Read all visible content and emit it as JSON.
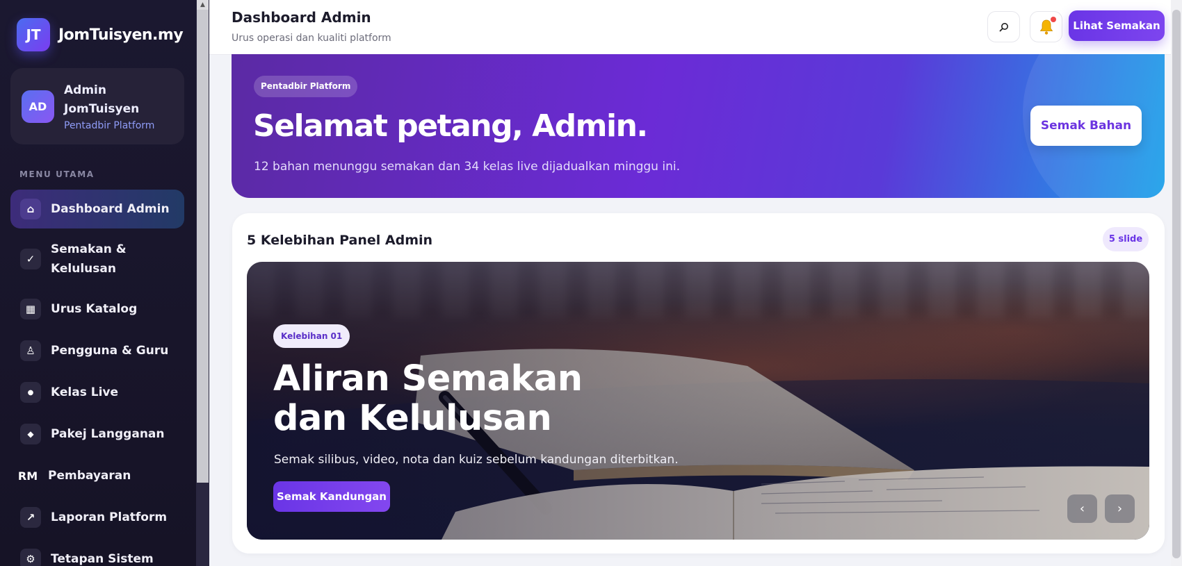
{
  "brand": {
    "logo": "JT",
    "name": "JomTuisyen.my"
  },
  "profile": {
    "initials": "AD",
    "name": "Admin JomTuisyen",
    "role": "Pentadbir Platform"
  },
  "menu": {
    "heading": "MENU UTAMA",
    "items": [
      {
        "label": "Dashboard Admin",
        "icon": "home-icon",
        "glyph": "⌂"
      },
      {
        "label": "Semakan & Kelulusan",
        "icon": "check-icon",
        "glyph": "✓"
      },
      {
        "label": "Urus Katalog",
        "icon": "grid-icon",
        "glyph": "▦"
      },
      {
        "label": "Pengguna & Guru",
        "icon": "user-icon",
        "glyph": "♙"
      },
      {
        "label": "Kelas Live",
        "icon": "dot-icon",
        "glyph": "●"
      },
      {
        "label": "Pakej Langganan",
        "icon": "diamond-icon",
        "glyph": "◆"
      },
      {
        "label": "Pembayaran",
        "icon": "currency-icon",
        "glyph": "RM"
      },
      {
        "label": "Laporan Platform",
        "icon": "trend-icon",
        "glyph": "↗"
      },
      {
        "label": "Tetapan Sistem",
        "icon": "gear-icon",
        "glyph": "⚙"
      }
    ]
  },
  "header": {
    "title": "Dashboard Admin",
    "subtitle": "Urus operasi dan kualiti platform",
    "primary_button": "Lihat Semakan"
  },
  "hero": {
    "badge": "Pentadbir Platform",
    "title": "Selamat petang, Admin.",
    "description": "12 bahan menunggu semakan dan 34 kelas live dijadualkan minggu ini.",
    "button": "Semak Bahan"
  },
  "features": {
    "title": "5 Kelebihan Panel Admin",
    "count_pill": "5 slide",
    "slide": {
      "badge": "Kelebihan 01",
      "title": "Aliran Semakan dan Kelulusan",
      "description": "Semak silibus, video, nota dan kuiz sebelum kandungan diterbitkan.",
      "button": "Semak Kandungan",
      "prev": "‹",
      "next": "›"
    }
  },
  "colors": {
    "accent": "#6a35e6",
    "sidebar_bg": "#1b1830",
    "hero_start": "#5b2aa4",
    "hero_end": "#1aa0ea",
    "notification_dot": "#f04848"
  }
}
